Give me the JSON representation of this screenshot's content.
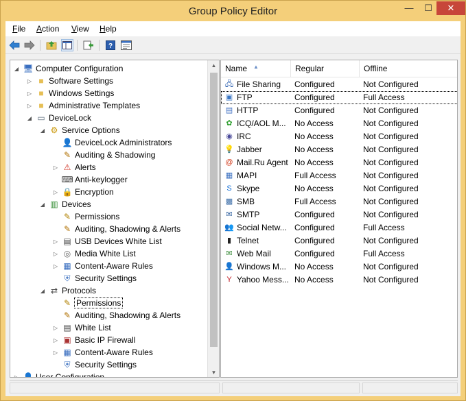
{
  "window": {
    "title": "Group Policy Editor",
    "minimize": "—",
    "maximize": "☐",
    "close": "✕"
  },
  "menu": {
    "items": [
      {
        "key": "F",
        "rest": "ile"
      },
      {
        "key": "A",
        "rest": "ction"
      },
      {
        "key": "V",
        "rest": "iew"
      },
      {
        "key": "H",
        "rest": "elp"
      }
    ]
  },
  "toolbar": {
    "icons": [
      "back-arrow-icon",
      "forward-arrow-icon",
      "up-folder-icon",
      "show-hide-tree-icon",
      "export-list-icon",
      "help-icon",
      "properties-icon"
    ]
  },
  "tree": {
    "nodes": [
      {
        "label": "Computer Configuration",
        "icon": "computer-icon",
        "level": 0,
        "expander": "◢"
      },
      {
        "label": "Software Settings",
        "icon": "folder-icon",
        "level": 1,
        "expander": "▷"
      },
      {
        "label": "Windows Settings",
        "icon": "folder-icon",
        "level": 1,
        "expander": "▷"
      },
      {
        "label": "Administrative Templates",
        "icon": "folder-icon",
        "level": 1,
        "expander": "▷"
      },
      {
        "label": "DeviceLock",
        "icon": "devicelock-icon",
        "level": 1,
        "expander": "◢"
      },
      {
        "label": "Service Options",
        "icon": "gear-icon",
        "level": 2,
        "expander": "◢"
      },
      {
        "label": "DeviceLock Administrators",
        "icon": "admins-icon",
        "level": 3,
        "expander": ""
      },
      {
        "label": "Auditing & Shadowing",
        "icon": "auditing-icon",
        "level": 3,
        "expander": ""
      },
      {
        "label": "Alerts",
        "icon": "alerts-icon",
        "level": 3,
        "expander": "▷"
      },
      {
        "label": "Anti-keylogger",
        "icon": "keyboard-icon",
        "level": 3,
        "expander": ""
      },
      {
        "label": "Encryption",
        "icon": "encryption-icon",
        "level": 3,
        "expander": "▷"
      },
      {
        "label": "Devices",
        "icon": "devices-icon",
        "level": 2,
        "expander": "◢"
      },
      {
        "label": "Permissions",
        "icon": "permissions-icon",
        "level": 3,
        "expander": ""
      },
      {
        "label": "Auditing, Shadowing & Alerts",
        "icon": "auditing-icon",
        "level": 3,
        "expander": ""
      },
      {
        "label": "USB Devices White List",
        "icon": "whitelist-icon",
        "level": 3,
        "expander": "▷"
      },
      {
        "label": "Media White List",
        "icon": "media-icon",
        "level": 3,
        "expander": "▷"
      },
      {
        "label": "Content-Aware Rules",
        "icon": "content-rules-icon",
        "level": 3,
        "expander": "▷"
      },
      {
        "label": "Security Settings",
        "icon": "security-icon",
        "level": 3,
        "expander": ""
      },
      {
        "label": "Protocols",
        "icon": "protocols-icon",
        "level": 2,
        "expander": "◢"
      },
      {
        "label": "Permissions",
        "icon": "permissions-icon",
        "level": 3,
        "expander": "",
        "selected": true
      },
      {
        "label": "Auditing, Shadowing & Alerts",
        "icon": "auditing-icon",
        "level": 3,
        "expander": ""
      },
      {
        "label": "White List",
        "icon": "whitelist-icon",
        "level": 3,
        "expander": "▷"
      },
      {
        "label": "Basic IP Firewall",
        "icon": "firewall-icon",
        "level": 3,
        "expander": "▷"
      },
      {
        "label": "Content-Aware Rules",
        "icon": "content-rules-icon",
        "level": 3,
        "expander": "▷"
      },
      {
        "label": "Security Settings",
        "icon": "security-icon",
        "level": 3,
        "expander": ""
      },
      {
        "label": "User Configuration",
        "icon": "user-config-icon",
        "level": 0,
        "expander": "▷"
      }
    ]
  },
  "list": {
    "columns": [
      "Name",
      "Regular",
      "Offline"
    ],
    "sort_indicator": "▲",
    "rows": [
      {
        "name": "File Sharing",
        "regular": "Configured",
        "offline": "Not Configured",
        "icon": "file-sharing-icon",
        "glyph": "🖧",
        "color": "#2b5fb0"
      },
      {
        "name": "FTP",
        "regular": "Configured",
        "offline": "Full Access",
        "icon": "ftp-icon",
        "glyph": "▣",
        "color": "#3a76c4",
        "focused": true
      },
      {
        "name": "HTTP",
        "regular": "Configured",
        "offline": "Not Configured",
        "icon": "http-icon",
        "glyph": "▤",
        "color": "#3c6ec2"
      },
      {
        "name": "ICQ/AOL M...",
        "regular": "No Access",
        "offline": "Not Configured",
        "icon": "icq-icon",
        "glyph": "✿",
        "color": "#2e9e2e"
      },
      {
        "name": "IRC",
        "regular": "No Access",
        "offline": "Not Configured",
        "icon": "irc-icon",
        "glyph": "◉",
        "color": "#4a4a9a"
      },
      {
        "name": "Jabber",
        "regular": "No Access",
        "offline": "Not Configured",
        "icon": "jabber-icon",
        "glyph": "💡",
        "color": "#d8b400"
      },
      {
        "name": "Mail.Ru Agent",
        "regular": "No Access",
        "offline": "Not Configured",
        "icon": "mailru-icon",
        "glyph": "@",
        "color": "#d23a1a"
      },
      {
        "name": "MAPI",
        "regular": "Full Access",
        "offline": "Not Configured",
        "icon": "mapi-icon",
        "glyph": "▦",
        "color": "#3a6fc0"
      },
      {
        "name": "Skype",
        "regular": "No Access",
        "offline": "Not Configured",
        "icon": "skype-icon",
        "glyph": "S",
        "color": "#1a73d8"
      },
      {
        "name": "SMB",
        "regular": "Full Access",
        "offline": "Not Configured",
        "icon": "smb-icon",
        "glyph": "▩",
        "color": "#3b6da8"
      },
      {
        "name": "SMTP",
        "regular": "Configured",
        "offline": "Not Configured",
        "icon": "smtp-icon",
        "glyph": "✉",
        "color": "#2e5f9e"
      },
      {
        "name": "Social Netw...",
        "regular": "Configured",
        "offline": "Full Access",
        "icon": "social-network-icon",
        "glyph": "👥",
        "color": "#c0392b"
      },
      {
        "name": "Telnet",
        "regular": "Configured",
        "offline": "Not Configured",
        "icon": "telnet-icon",
        "glyph": "▮",
        "color": "#222222"
      },
      {
        "name": "Web Mail",
        "regular": "Configured",
        "offline": "Full Access",
        "icon": "webmail-icon",
        "glyph": "✉",
        "color": "#3c8d3c"
      },
      {
        "name": "Windows M...",
        "regular": "No Access",
        "offline": "Not Configured",
        "icon": "windows-messenger-icon",
        "glyph": "👤",
        "color": "#2d8a2d"
      },
      {
        "name": "Yahoo Mess...",
        "regular": "No Access",
        "offline": "Not Configured",
        "icon": "yahoo-icon",
        "glyph": "Y",
        "color": "#c0161e"
      }
    ]
  }
}
